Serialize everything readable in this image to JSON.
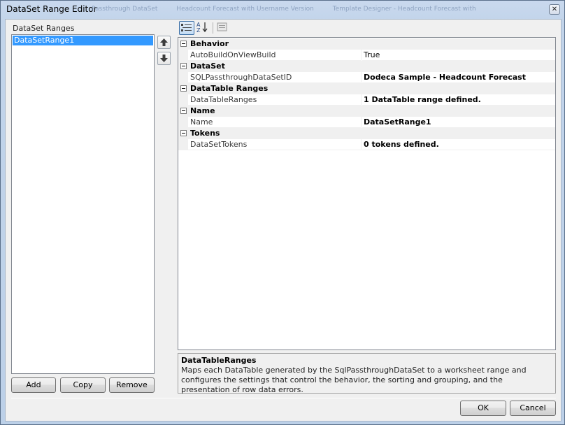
{
  "window": {
    "title": "DataSet Range Editor",
    "background_titles": [
      "DataSet Range Editor",
      "Passthrough DataSet",
      "Headcount Forecast with Username Version",
      "Template Designer - Headcount Forecast with"
    ],
    "close_glyph": "✕"
  },
  "left_panel": {
    "label": "DataSet Ranges",
    "items": [
      {
        "label": "DataSetRange1",
        "selected": true
      }
    ],
    "buttons": {
      "add": "Add",
      "copy": "Copy",
      "remove": "Remove"
    }
  },
  "move_buttons": {
    "up_icon": "arrow-up-icon",
    "down_icon": "arrow-down-icon"
  },
  "toolbar": {
    "categorized_icon": "categorized-icon",
    "alphabetical_icon": "sort-alphabetical-icon",
    "property_pages_icon": "property-pages-icon"
  },
  "property_grid": {
    "categories": [
      {
        "label": "Behavior",
        "props": [
          {
            "name": "AutoBuildOnViewBuild",
            "value": "True",
            "bold": false
          }
        ]
      },
      {
        "label": "DataSet",
        "props": [
          {
            "name": "SQLPassthroughDataSetID",
            "value": "Dodeca Sample - Headcount Forecast",
            "bold": true
          }
        ]
      },
      {
        "label": "DataTable Ranges",
        "props": [
          {
            "name": "DataTableRanges",
            "value": "1 DataTable range defined.",
            "bold": true
          }
        ]
      },
      {
        "label": "Name",
        "props": [
          {
            "name": "Name",
            "value": "DataSetRange1",
            "bold": true
          }
        ]
      },
      {
        "label": "Tokens",
        "props": [
          {
            "name": "DataSetTokens",
            "value": "0 tokens defined.",
            "bold": true
          }
        ]
      }
    ]
  },
  "description": {
    "title": "DataTableRanges",
    "text": "Maps each DataTable generated by the SqlPassthroughDataSet to a worksheet range and configures the settings that control the behavior, the sorting and grouping, and the presentation of row data errors."
  },
  "footer": {
    "ok": "OK",
    "cancel": "Cancel"
  },
  "colors": {
    "selection": "#3399ff",
    "client_bg": "#f0f0f0",
    "frame": "#c2d4ea"
  }
}
